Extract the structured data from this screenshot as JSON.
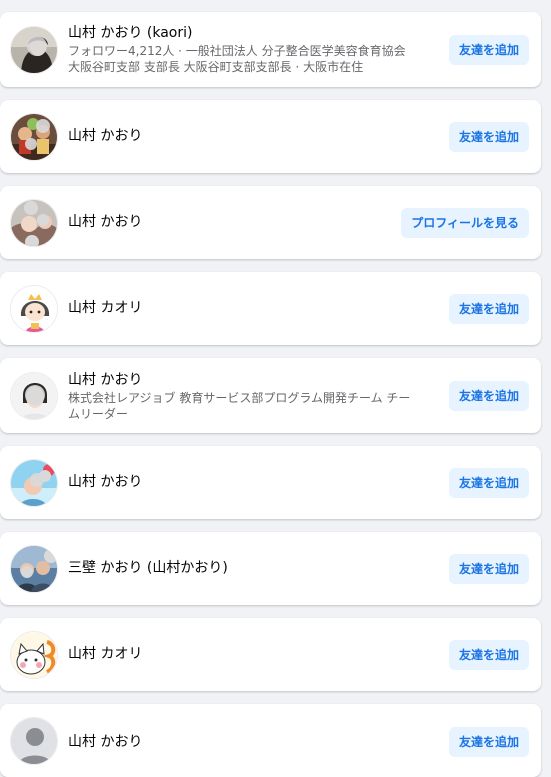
{
  "results": [
    {
      "name": "山村 かおり (kaori)",
      "subtitle": "フォロワー4,212人 · 一般社団法人 分子整合医学美容食育協会 大阪谷町支部 支部長 大阪谷町支部支部長 · 大阪市在住",
      "action": "友達を追加",
      "avatar_icon": "profile-photo-woman"
    },
    {
      "name": "山村 かおり",
      "subtitle": "",
      "action": "友達を追加",
      "avatar_icon": "profile-photo-group"
    },
    {
      "name": "山村 かおり",
      "subtitle": "",
      "action": "プロフィールを見る",
      "avatar_icon": "profile-photo-child"
    },
    {
      "name": "山村 カオリ",
      "subtitle": "",
      "action": "友達を追加",
      "avatar_icon": "profile-illustration-princess"
    },
    {
      "name": "山村 かおり",
      "subtitle": "株式会社レアジョブ 教育サービス部プログラム開発チーム チームリーダー",
      "action": "友達を追加",
      "avatar_icon": "profile-photo-portrait"
    },
    {
      "name": "山村 かおり",
      "subtitle": "",
      "action": "友達を追加",
      "avatar_icon": "profile-photo-outdoor"
    },
    {
      "name": "三壁 かおり (山村かおり)",
      "subtitle": "",
      "action": "友達を追加",
      "avatar_icon": "profile-photo-family"
    },
    {
      "name": "山村 カオリ",
      "subtitle": "",
      "action": "友達を追加",
      "avatar_icon": "profile-illustration-cat"
    },
    {
      "name": "山村 かおり",
      "subtitle": "",
      "action": "友達を追加",
      "avatar_icon": "default-avatar-icon"
    }
  ],
  "colors": {
    "page_background": "#f0f2f5",
    "card_background": "#ffffff",
    "button_background": "#e7f3ff",
    "button_text": "#1b74e4",
    "secondary_text": "#65676b"
  }
}
